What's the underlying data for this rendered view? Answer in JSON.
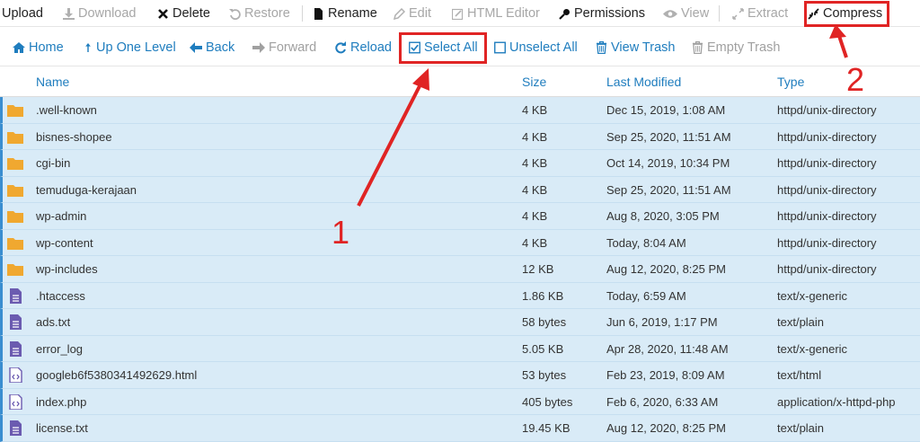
{
  "toolbar": {
    "items": [
      {
        "label": "Upload",
        "icon": "upload-icon",
        "enabled": true
      },
      {
        "label": "Download",
        "icon": "download-icon",
        "enabled": false
      },
      {
        "label": "Delete",
        "icon": "x-icon",
        "enabled": true
      },
      {
        "label": "Restore",
        "icon": "restore-icon",
        "enabled": false
      },
      {
        "label": "Rename",
        "icon": "file-icon",
        "enabled": true
      },
      {
        "label": "Edit",
        "icon": "pencil-icon",
        "enabled": false
      },
      {
        "label": "HTML Editor",
        "icon": "html-editor-icon",
        "enabled": false
      },
      {
        "label": "Permissions",
        "icon": "key-icon",
        "enabled": true
      },
      {
        "label": "View",
        "icon": "eye-icon",
        "enabled": false
      },
      {
        "label": "Extract",
        "icon": "extract-icon",
        "enabled": false
      },
      {
        "label": "Compress",
        "icon": "compress-icon",
        "enabled": true
      }
    ]
  },
  "nav": {
    "items": [
      {
        "label": "Home",
        "icon": "home-icon",
        "enabled": true
      },
      {
        "label": "Up One Level",
        "icon": "level-up-icon",
        "enabled": true
      },
      {
        "label": "Back",
        "icon": "arrow-left-icon",
        "enabled": true
      },
      {
        "label": "Forward",
        "icon": "arrow-right-icon",
        "enabled": false
      },
      {
        "label": "Reload",
        "icon": "reload-icon",
        "enabled": true
      },
      {
        "label": "Select All",
        "icon": "checkbox-checked-icon",
        "enabled": true
      },
      {
        "label": "Unselect All",
        "icon": "checkbox-empty-icon",
        "enabled": true
      },
      {
        "label": "View Trash",
        "icon": "trash-icon",
        "enabled": true
      },
      {
        "label": "Empty Trash",
        "icon": "trash-icon",
        "enabled": false
      }
    ]
  },
  "table": {
    "columns": [
      "Name",
      "Size",
      "Last Modified",
      "Type"
    ],
    "rows": [
      {
        "name": ".well-known",
        "size": "4 KB",
        "modified": "Dec 15, 2019, 1:08 AM",
        "type": "httpd/unix-directory",
        "kind": "folder"
      },
      {
        "name": "bisnes-shopee",
        "size": "4 KB",
        "modified": "Sep 25, 2020, 11:51 AM",
        "type": "httpd/unix-directory",
        "kind": "folder"
      },
      {
        "name": "cgi-bin",
        "size": "4 KB",
        "modified": "Oct 14, 2019, 10:34 PM",
        "type": "httpd/unix-directory",
        "kind": "folder"
      },
      {
        "name": "temuduga-kerajaan",
        "size": "4 KB",
        "modified": "Sep 25, 2020, 11:51 AM",
        "type": "httpd/unix-directory",
        "kind": "folder"
      },
      {
        "name": "wp-admin",
        "size": "4 KB",
        "modified": "Aug 8, 2020, 3:05 PM",
        "type": "httpd/unix-directory",
        "kind": "folder"
      },
      {
        "name": "wp-content",
        "size": "4 KB",
        "modified": "Today, 8:04 AM",
        "type": "httpd/unix-directory",
        "kind": "folder"
      },
      {
        "name": "wp-includes",
        "size": "12 KB",
        "modified": "Aug 12, 2020, 8:25 PM",
        "type": "httpd/unix-directory",
        "kind": "folder"
      },
      {
        "name": ".htaccess",
        "size": "1.86 KB",
        "modified": "Today, 6:59 AM",
        "type": "text/x-generic",
        "kind": "text"
      },
      {
        "name": "ads.txt",
        "size": "58 bytes",
        "modified": "Jun 6, 2019, 1:17 PM",
        "type": "text/plain",
        "kind": "text"
      },
      {
        "name": "error_log",
        "size": "5.05 KB",
        "modified": "Apr 28, 2020, 11:48 AM",
        "type": "text/x-generic",
        "kind": "text"
      },
      {
        "name": "googleb6f5380341492629.html",
        "size": "53 bytes",
        "modified": "Feb 23, 2019, 8:09 AM",
        "type": "text/html",
        "kind": "code"
      },
      {
        "name": "index.php",
        "size": "405 bytes",
        "modified": "Feb 6, 2020, 6:33 AM",
        "type": "application/x-httpd-php",
        "kind": "code"
      },
      {
        "name": "license.txt",
        "size": "19.45 KB",
        "modified": "Aug 12, 2020, 8:25 PM",
        "type": "text/plain",
        "kind": "text"
      }
    ]
  },
  "annotations": {
    "step1": "1",
    "step2": "2"
  },
  "colors": {
    "accent": "#1f7dbe",
    "selected_row": "#d9ebf7",
    "annotation": "#e02424",
    "folder": "#f0a830",
    "text_file": "#6b5bb0"
  }
}
